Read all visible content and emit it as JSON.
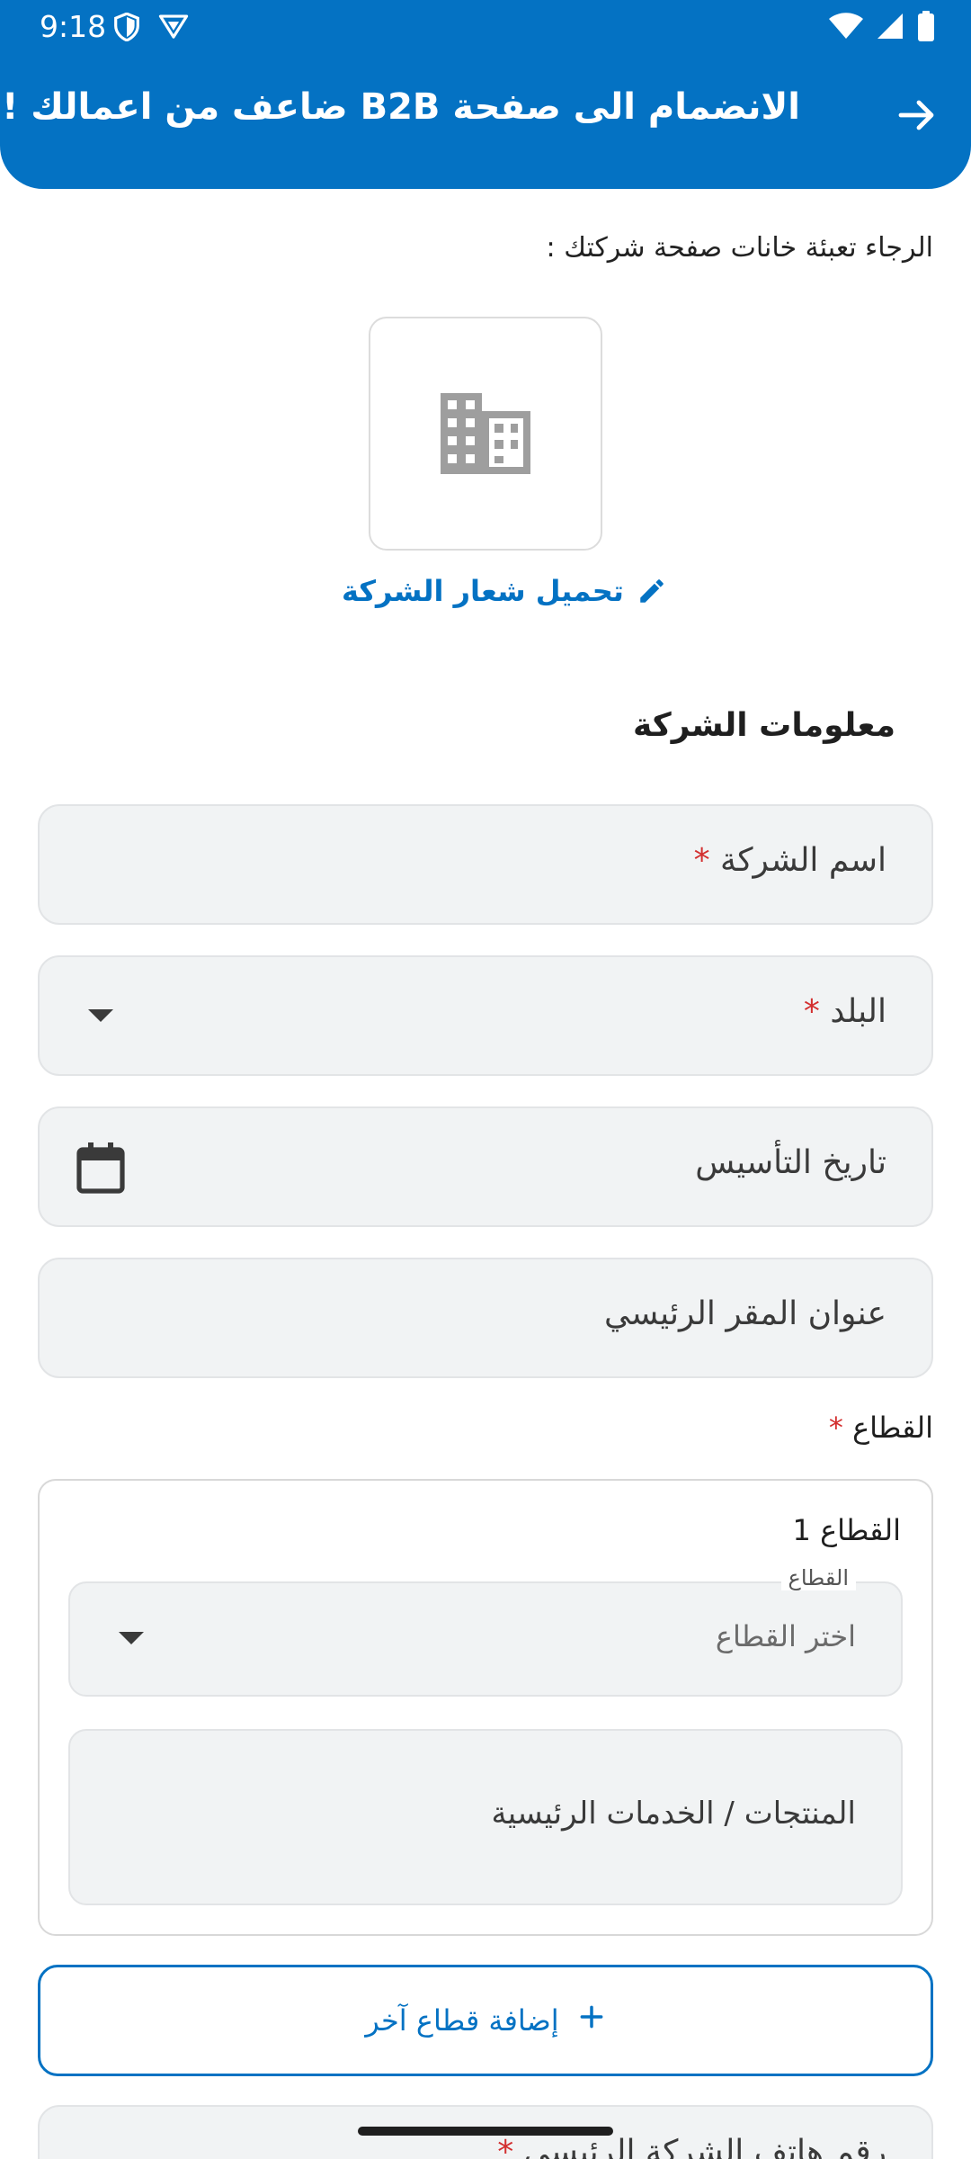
{
  "status_bar": {
    "time": "9:18"
  },
  "header": {
    "title": "الانضمام الى صفحة B2B ضاعف من اعمالك !"
  },
  "instructions": "الرجاء تعبئة خانات صفحة شركتك :",
  "logo_upload": {
    "label": "تحميل شعار الشركة"
  },
  "company_section": {
    "title": "معلومات الشركة"
  },
  "fields": {
    "company_name": {
      "label": "اسم الشركة",
      "required_mark": "*"
    },
    "country": {
      "label": "البلد",
      "required_mark": "*"
    },
    "founding_date": {
      "label": "تاريخ التأسيس"
    },
    "hq_address": {
      "label": "عنوان المقر الرئيسي"
    }
  },
  "sector": {
    "label": "القطاع",
    "required_mark": "*",
    "card_title": "القطاع 1",
    "select_float_label": "القطاع",
    "select_placeholder": "اختر القطاع",
    "products_label": "المنتجات / الخدمات الرئيسية"
  },
  "add_sector_button": {
    "label": "إضافة قطاع آخر"
  },
  "next_field": {
    "label": "رقم هاتف الشركة الرئيسي",
    "required_mark": "*"
  },
  "colors": {
    "primary": "#0472c3",
    "required": "#d32f2f",
    "field_bg": "#f1f3f4"
  }
}
